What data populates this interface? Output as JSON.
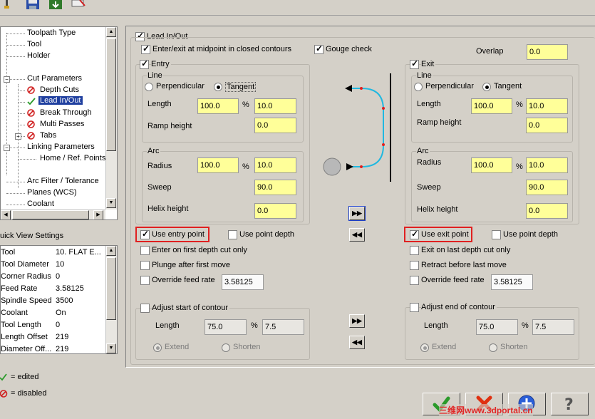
{
  "toolbar": {
    "icons": [
      "wrench-icon",
      "save-icon",
      "import-icon",
      "clear-icon"
    ]
  },
  "tree": {
    "items": [
      {
        "label": "Toolpath Type",
        "name": "tree-item-toolpath-type",
        "icon": ""
      },
      {
        "label": "Tool",
        "name": "tree-item-tool",
        "icon": ""
      },
      {
        "label": "Holder",
        "name": "tree-item-holder",
        "icon": ""
      },
      {
        "label": "Cut Parameters",
        "name": "tree-item-cut-parameters",
        "icon": ""
      },
      {
        "label": "Depth Cuts",
        "name": "tree-item-depth-cuts",
        "icon": "disabled"
      },
      {
        "label": "Lead In/Out",
        "name": "tree-item-lead-in-out",
        "icon": "edited"
      },
      {
        "label": "Break Through",
        "name": "tree-item-break-through",
        "icon": "disabled"
      },
      {
        "label": "Multi Passes",
        "name": "tree-item-multi-passes",
        "icon": "disabled"
      },
      {
        "label": "Tabs",
        "name": "tree-item-tabs",
        "icon": "disabled"
      },
      {
        "label": "Linking Parameters",
        "name": "tree-item-linking-parameters",
        "icon": ""
      },
      {
        "label": "Home / Ref. Points",
        "name": "tree-item-home-ref-points",
        "icon": ""
      },
      {
        "label": "Arc Filter / Tolerance",
        "name": "tree-item-arc-filter",
        "icon": ""
      },
      {
        "label": "Planes (WCS)",
        "name": "tree-item-planes",
        "icon": ""
      },
      {
        "label": "Coolant",
        "name": "tree-item-coolant",
        "icon": ""
      }
    ]
  },
  "quick_view": {
    "title": "uick View Settings",
    "rows": [
      {
        "key": "Tool",
        "value": "10. FLAT E..."
      },
      {
        "key": "Tool Diameter",
        "value": "10"
      },
      {
        "key": "Corner Radius",
        "value": "0"
      },
      {
        "key": "Feed Rate",
        "value": "3.58125"
      },
      {
        "key": "Spindle Speed",
        "value": "3500"
      },
      {
        "key": "Coolant",
        "value": "On"
      },
      {
        "key": "Tool Length",
        "value": "0"
      },
      {
        "key": "Length Offset",
        "value": "219"
      },
      {
        "key": "Diameter Off...",
        "value": "219"
      }
    ]
  },
  "legend": {
    "edited": "= edited",
    "disabled": "= disabled"
  },
  "lead": {
    "lead_in_out": {
      "label": "Lead In/Out",
      "checked": true
    },
    "midpoint": {
      "label": "Enter/exit at midpoint in closed contours",
      "checked": true
    },
    "gouge": {
      "label": "Gouge check",
      "checked": true
    },
    "overlap_label": "Overlap",
    "overlap_value": "0.0"
  },
  "entry": {
    "title": "Entry",
    "line_label": "Line",
    "perpendicular": "Perpendicular",
    "tangent": "Tangent",
    "length_label": "Length",
    "length_value": "100.0",
    "length_pct": "%",
    "length_abs": "10.0",
    "ramp_label": "Ramp height",
    "ramp_value": "0.0",
    "arc_label": "Arc",
    "radius_label": "Radius",
    "radius_value": "100.0",
    "radius_pct": "%",
    "radius_abs": "10.0",
    "sweep_label": "Sweep",
    "sweep_value": "90.0",
    "helix_label": "Helix height",
    "helix_value": "0.0",
    "use_point": "Use entry point",
    "use_depth": "Use point depth",
    "first_depth": "Enter on first depth cut only",
    "plunge": "Plunge after first move",
    "override": "Override feed rate",
    "override_value": "3.58125",
    "adjust": "Adjust start of contour",
    "adj_length_label": "Length",
    "adj_length_value": "75.0",
    "adj_pct": "%",
    "adj_abs": "7.5",
    "extend": "Extend",
    "shorten": "Shorten"
  },
  "exit": {
    "title": "Exit",
    "line_label": "Line",
    "perpendicular": "Perpendicular",
    "tangent": "Tangent",
    "length_label": "Length",
    "length_value": "100.0",
    "length_pct": "%",
    "length_abs": "10.0",
    "ramp_label": "Ramp height",
    "ramp_value": "0.0",
    "arc_label": "Arc",
    "radius_label": "Radius",
    "radius_value": "100.0",
    "radius_pct": "%",
    "radius_abs": "10.0",
    "sweep_label": "Sweep",
    "sweep_value": "90.0",
    "helix_label": "Helix height",
    "helix_value": "0.0",
    "use_point": "Use exit point",
    "use_depth": "Use point depth",
    "last_depth": "Exit on last depth cut only",
    "retract": "Retract before last move",
    "override": "Override feed rate",
    "override_value": "3.58125",
    "adjust": "Adjust end of contour",
    "adj_length_label": "Length",
    "adj_length_value": "75.0",
    "adj_pct": "%",
    "adj_abs": "7.5",
    "extend": "Extend",
    "shorten": "Shorten"
  },
  "footer": {
    "watermark": "三维网www.3dportal.cn"
  },
  "colors": {
    "highlight_bg": "#ffff99",
    "accent_red": "#e02020",
    "path_cyan": "#20b8e0",
    "selected_bg": "#1f3f9f"
  }
}
